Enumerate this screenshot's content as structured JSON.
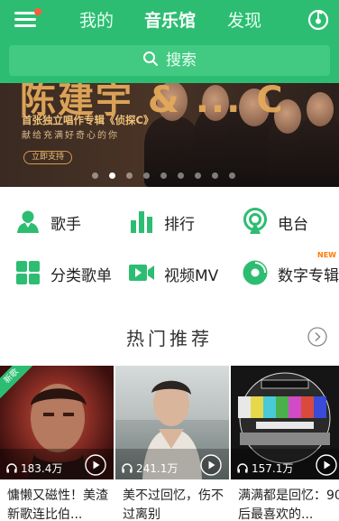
{
  "colors": {
    "accent": "#2dbd72",
    "search_bg": "#42c982",
    "badge_red": "#ff5a3a",
    "new_orange": "#ff7a00"
  },
  "topbar": {
    "tabs": [
      {
        "label": "我的",
        "active": false
      },
      {
        "label": "音乐馆",
        "active": true
      },
      {
        "label": "发现",
        "active": false
      }
    ],
    "menu_icon": "menu-icon",
    "player_icon": "music-player-icon"
  },
  "search": {
    "placeholder": "搜索",
    "icon": "search-icon"
  },
  "banner": {
    "big_title": "陈建宇 & ... C",
    "subtitle": "首张独立唱作专辑《侦探C》",
    "tagline": "献给充满好奇心的你",
    "support_label": "立即支持",
    "slide_count": 9,
    "active_slide": 2
  },
  "shortcuts": [
    {
      "label": "歌手",
      "icon": "singer-icon"
    },
    {
      "label": "排行",
      "icon": "chart-icon"
    },
    {
      "label": "电台",
      "icon": "radio-icon"
    },
    {
      "label": "分类歌单",
      "icon": "category-icon"
    },
    {
      "label": "视频MV",
      "icon": "video-icon"
    },
    {
      "label": "数字专辑",
      "icon": "digital-album-icon"
    }
  ],
  "new_badge": "NEW",
  "hot": {
    "title": "热门推荐",
    "more_icon": "chevron-right-icon",
    "cards": [
      {
        "count": "183.4万",
        "title": "慵懒又磁性！美渣新歌连比伯...",
        "tag": "新歌"
      },
      {
        "count": "241.1万",
        "title": "美不过回忆，伤不过离别"
      },
      {
        "count": "157.1万",
        "title": "满满都是回忆：90后最喜欢的..."
      }
    ]
  }
}
